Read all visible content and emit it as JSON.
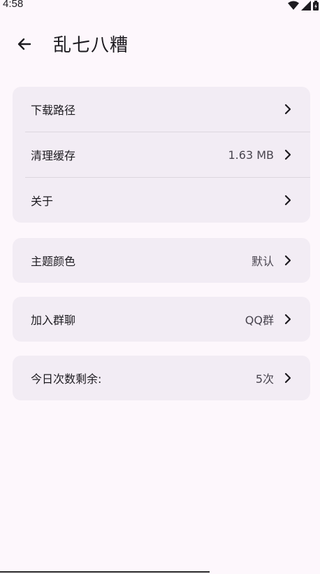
{
  "status_bar": {
    "time": "4:58"
  },
  "header": {
    "title": "乱七八糟"
  },
  "groups": [
    {
      "items": [
        {
          "label": "下载路径",
          "value": ""
        },
        {
          "label": "清理缓存",
          "value": "1.63 MB"
        },
        {
          "label": "关于",
          "value": ""
        }
      ]
    },
    {
      "items": [
        {
          "label": "主题颜色",
          "value": "默认"
        }
      ]
    },
    {
      "items": [
        {
          "label": "加入群聊",
          "value": "QQ群"
        }
      ]
    },
    {
      "items": [
        {
          "label": "今日次数剩余:",
          "value": "5次"
        }
      ]
    }
  ],
  "colors": {
    "background": "#fdf7fc",
    "card": "#f2ecf4",
    "text": "#1d1b20",
    "secondary_text": "#49454f"
  },
  "icons": {
    "back": "arrow-left-icon",
    "chevron": "chevron-right-icon",
    "wifi": "wifi-icon",
    "signal": "signal-icon",
    "battery": "battery-icon"
  }
}
